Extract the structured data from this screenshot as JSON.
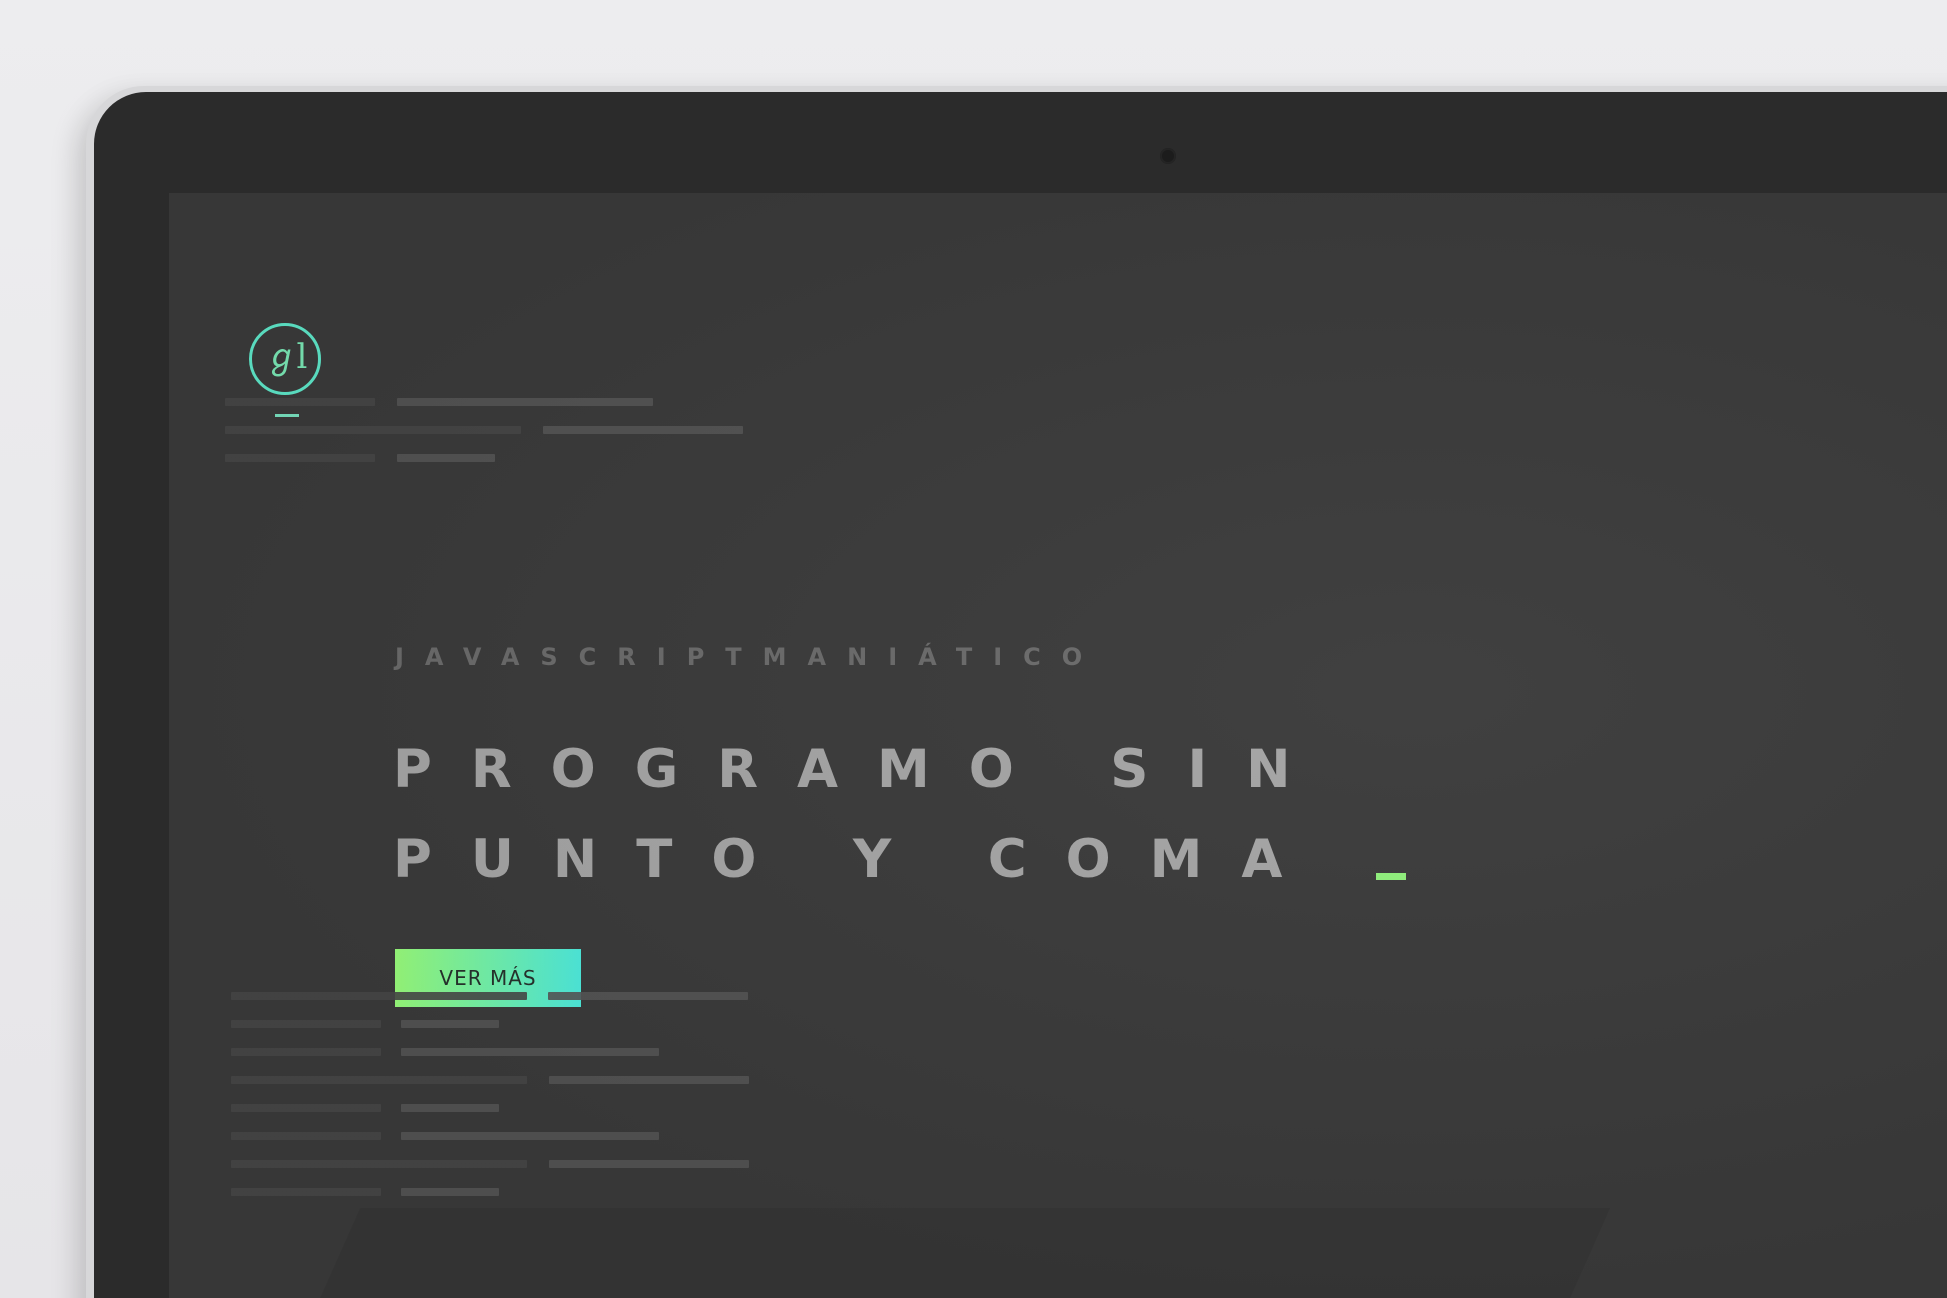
{
  "brand": {
    "logo_icon": "jm-monogram-icon",
    "logo_text": "ℊl",
    "accent_green": "#98fb7a",
    "accent_cyan": "#4deadc"
  },
  "hero": {
    "kicker": "JAVASCRIPTMANIÁTICO",
    "headline_line1": "PROGRAMO SIN",
    "headline_line2": "PUNTO Y COMA",
    "cta_label": "VER MÁS"
  },
  "device": {
    "camera_icon": "camera-icon"
  }
}
